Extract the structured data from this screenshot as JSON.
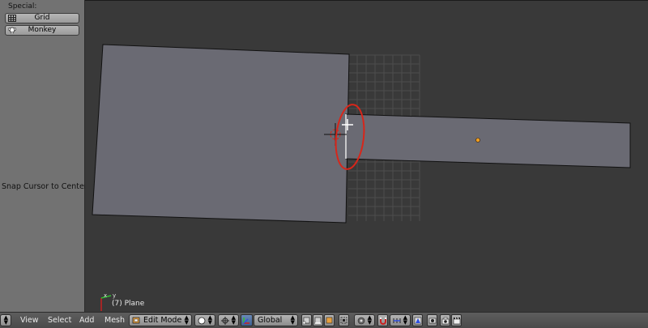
{
  "toolshelf": {
    "section_title": "Special:",
    "buttons": [
      {
        "label": "Grid",
        "icon": "grid-icon"
      },
      {
        "label": "Monkey",
        "icon": "monkey-icon"
      }
    ],
    "last_operator": "Snap Cursor to Center"
  },
  "viewport": {
    "axis_y_label": "y",
    "axis_x_label": "x",
    "object_info": "(7) Plane"
  },
  "header": {
    "menus": [
      "View",
      "Select",
      "Add",
      "Mesh"
    ],
    "mode": "Edit Mode",
    "orientation": "Global"
  },
  "colors": {
    "viewport_bg": "#393939",
    "mesh_face": "#6a6a73",
    "annotation_red": "#d8261a",
    "origin_dot": "#f0a020"
  }
}
